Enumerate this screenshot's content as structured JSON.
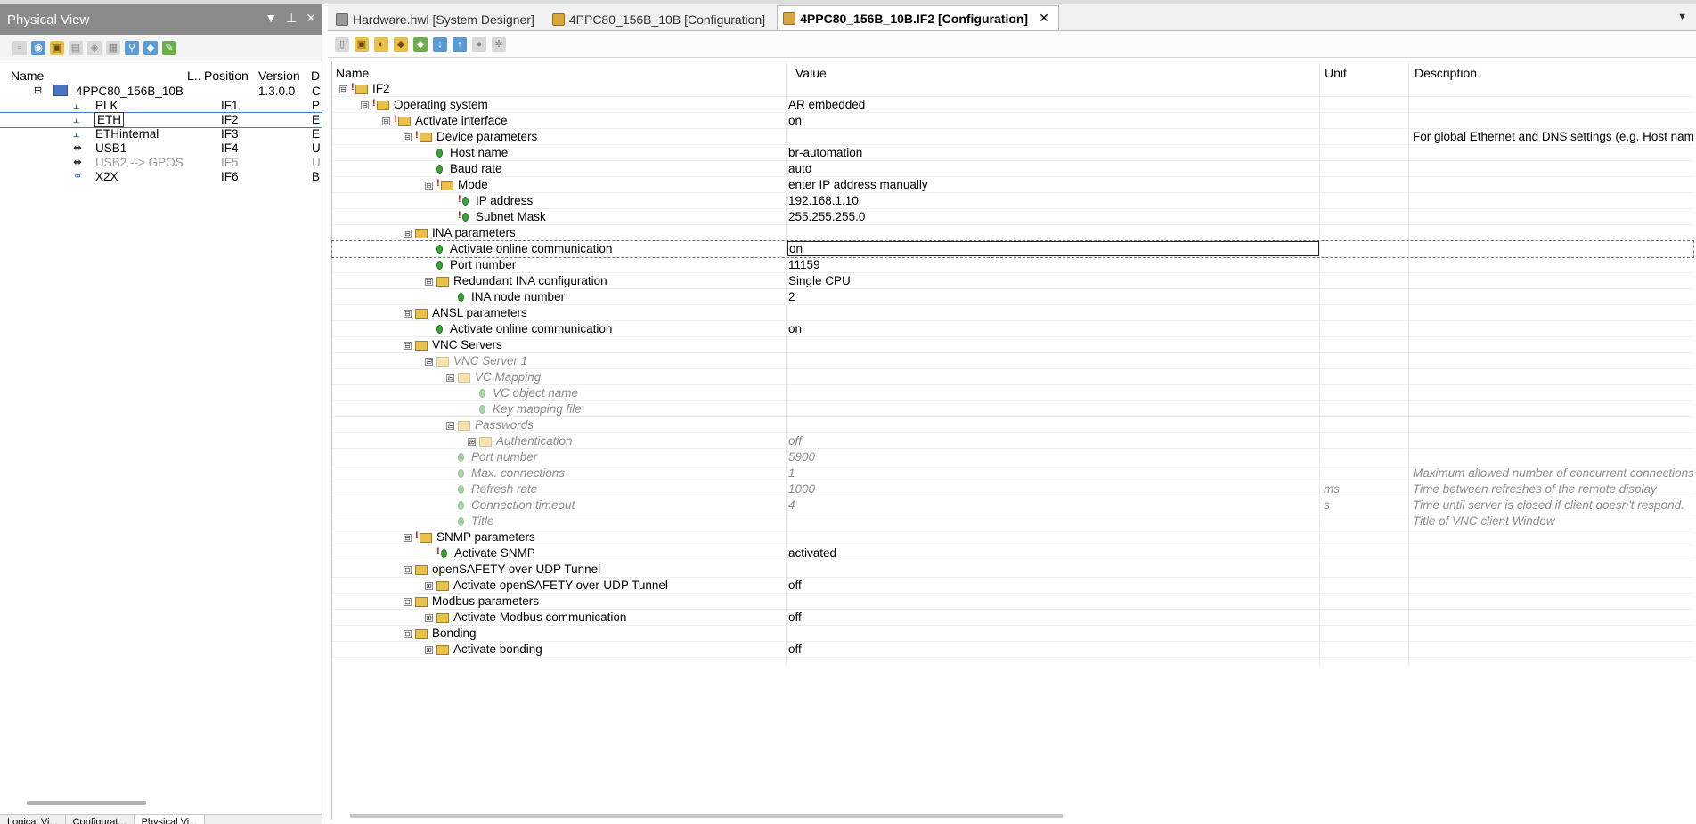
{
  "left_pane": {
    "title": "Physical View",
    "controls": [
      "▼",
      "⊥",
      "✕"
    ],
    "columns": {
      "name": "Name",
      "l": "L..",
      "position": "Position",
      "version": "Version",
      "d": "D"
    },
    "items": [
      {
        "name": "4PPC80_156B_10B",
        "position": "",
        "version": "1.3.0.0",
        "d": "C",
        "indent": 0,
        "kind": "device",
        "expander": "⊟"
      },
      {
        "name": "PLK",
        "position": "IF1",
        "version": "",
        "d": "P",
        "indent": 1,
        "kind": "net"
      },
      {
        "name": "ETH",
        "position": "IF2",
        "version": "",
        "d": "E",
        "indent": 1,
        "kind": "net",
        "selected": true
      },
      {
        "name": "ETHinternal",
        "position": "IF3",
        "version": "",
        "d": "E",
        "indent": 1,
        "kind": "net"
      },
      {
        "name": "USB1",
        "position": "IF4",
        "version": "",
        "d": "U",
        "indent": 1,
        "kind": "usb"
      },
      {
        "name": "USB2 --> GPOS",
        "position": "IF5",
        "version": "",
        "d": "U",
        "indent": 1,
        "kind": "usb",
        "grey": true
      },
      {
        "name": "X2X",
        "position": "IF6",
        "version": "",
        "d": "B",
        "indent": 1,
        "kind": "x2x"
      }
    ],
    "bottom_tabs": [
      "Logical Vi...",
      "Configurat...",
      "Physical Vi..."
    ]
  },
  "tabs": [
    {
      "label": "Hardware.hwl [System Designer]",
      "active": false,
      "icon": "hardware-icon"
    },
    {
      "label": "4PPC80_156B_10B [Configuration]",
      "active": false,
      "icon": "configuration-icon"
    },
    {
      "label": "4PPC80_156B_10B.IF2 [Configuration]",
      "active": true,
      "icon": "configuration-icon",
      "close": "✕"
    }
  ],
  "tab_menu_glyph": "▼",
  "grid": {
    "columns": {
      "name": "Name",
      "value": "Value",
      "unit": "Unit",
      "description": "Description"
    },
    "rows": [
      {
        "level": 0,
        "exp": "⊟",
        "type": "folder",
        "warn": true,
        "name": "IF2",
        "value": "",
        "unit": "",
        "desc": ""
      },
      {
        "level": 1,
        "exp": "⊟",
        "type": "folder",
        "warn": true,
        "name": "Operating system",
        "value": "AR embedded",
        "unit": "",
        "desc": ""
      },
      {
        "level": 2,
        "exp": "⊟",
        "type": "folder",
        "warn": true,
        "name": "Activate interface",
        "value": "on",
        "unit": "",
        "desc": ""
      },
      {
        "level": 3,
        "exp": "⊟",
        "type": "folder",
        "warn": true,
        "name": "Device parameters",
        "value": "",
        "unit": "",
        "desc": "For global Ethernet and DNS settings (e.g. Host name"
      },
      {
        "level": 4,
        "exp": "",
        "type": "leaf",
        "warn": false,
        "name": "Host name",
        "value": "br-automation",
        "unit": "",
        "desc": ""
      },
      {
        "level": 4,
        "exp": "",
        "type": "leaf",
        "warn": false,
        "name": "Baud rate",
        "value": "auto",
        "unit": "",
        "desc": ""
      },
      {
        "level": 4,
        "exp": "⊟",
        "type": "folder",
        "warn": true,
        "name": "Mode",
        "value": "enter IP address manually",
        "unit": "",
        "desc": ""
      },
      {
        "level": 5,
        "exp": "",
        "type": "leaf",
        "warn": true,
        "name": "IP address",
        "value": "192.168.1.10",
        "unit": "",
        "desc": ""
      },
      {
        "level": 5,
        "exp": "",
        "type": "leaf",
        "warn": true,
        "name": "Subnet Mask",
        "value": "255.255.255.0",
        "unit": "",
        "desc": ""
      },
      {
        "level": 3,
        "exp": "⊟",
        "type": "folder",
        "warn": false,
        "name": "INA parameters",
        "value": "",
        "unit": "",
        "desc": ""
      },
      {
        "level": 4,
        "exp": "",
        "type": "leaf",
        "warn": false,
        "name": "Activate online communication",
        "value": "on",
        "unit": "",
        "desc": "",
        "selected": true
      },
      {
        "level": 4,
        "exp": "",
        "type": "leaf",
        "warn": false,
        "name": "Port number",
        "value": "11159",
        "unit": "",
        "desc": ""
      },
      {
        "level": 4,
        "exp": "⊟",
        "type": "folder",
        "warn": false,
        "name": "Redundant INA configuration",
        "value": "Single CPU",
        "unit": "",
        "desc": ""
      },
      {
        "level": 5,
        "exp": "",
        "type": "leaf",
        "warn": false,
        "name": "INA node number",
        "value": "2",
        "unit": "",
        "desc": ""
      },
      {
        "level": 3,
        "exp": "⊟",
        "type": "folder",
        "warn": false,
        "name": "ANSL parameters",
        "value": "",
        "unit": "",
        "desc": ""
      },
      {
        "level": 4,
        "exp": "",
        "type": "leaf",
        "warn": false,
        "name": "Activate online communication",
        "value": "on",
        "unit": "",
        "desc": ""
      },
      {
        "level": 3,
        "exp": "⊟",
        "type": "folder",
        "warn": false,
        "name": "VNC Servers",
        "value": "",
        "unit": "",
        "desc": ""
      },
      {
        "level": 4,
        "exp": "⊟",
        "type": "folder",
        "warn": false,
        "name": "VNC Server 1",
        "value": "",
        "unit": "",
        "desc": "",
        "italic": true
      },
      {
        "level": 5,
        "exp": "⊟",
        "type": "folder",
        "warn": false,
        "name": "VC Mapping",
        "value": "",
        "unit": "",
        "desc": "",
        "italic": true
      },
      {
        "level": 6,
        "exp": "",
        "type": "leaf",
        "warn": false,
        "name": "VC object name",
        "value": "",
        "unit": "",
        "desc": "",
        "italic": true
      },
      {
        "level": 6,
        "exp": "",
        "type": "leaf",
        "warn": false,
        "name": "Key mapping file",
        "value": "",
        "unit": "",
        "desc": "",
        "italic": true
      },
      {
        "level": 5,
        "exp": "⊟",
        "type": "folder",
        "warn": false,
        "name": "Passwords",
        "value": "",
        "unit": "",
        "desc": "",
        "italic": true
      },
      {
        "level": 6,
        "exp": "⊞",
        "type": "folder",
        "warn": false,
        "name": "Authentication",
        "value": "off",
        "unit": "",
        "desc": "",
        "italic": true
      },
      {
        "level": 5,
        "exp": "",
        "type": "leaf",
        "warn": false,
        "name": "Port number",
        "value": "5900",
        "unit": "",
        "desc": "",
        "italic": true
      },
      {
        "level": 5,
        "exp": "",
        "type": "leaf",
        "warn": false,
        "name": "Max. connections",
        "value": "1",
        "unit": "",
        "desc": "Maximum allowed number of concurrent connections",
        "italic": true
      },
      {
        "level": 5,
        "exp": "",
        "type": "leaf",
        "warn": false,
        "name": "Refresh rate",
        "value": "1000",
        "unit": "ms",
        "desc": "Time between refreshes of the remote display",
        "italic": true
      },
      {
        "level": 5,
        "exp": "",
        "type": "leaf",
        "warn": false,
        "name": "Connection timeout",
        "value": "4",
        "unit": "s",
        "desc": "Time until server is closed if client doesn't respond.",
        "italic": true
      },
      {
        "level": 5,
        "exp": "",
        "type": "leaf",
        "warn": false,
        "name": "Title",
        "value": "",
        "unit": "",
        "desc": "Title of VNC client Window",
        "italic": true
      },
      {
        "level": 3,
        "exp": "⊟",
        "type": "folder",
        "warn": true,
        "name": "SNMP parameters",
        "value": "",
        "unit": "",
        "desc": ""
      },
      {
        "level": 4,
        "exp": "",
        "type": "leaf",
        "warn": true,
        "name": "Activate SNMP",
        "value": "activated",
        "unit": "",
        "desc": ""
      },
      {
        "level": 3,
        "exp": "⊟",
        "type": "folder",
        "warn": false,
        "name": "openSAFETY-over-UDP Tunnel",
        "value": "",
        "unit": "",
        "desc": ""
      },
      {
        "level": 4,
        "exp": "⊞",
        "type": "folder",
        "warn": false,
        "name": "Activate openSAFETY-over-UDP Tunnel",
        "value": "off",
        "unit": "",
        "desc": ""
      },
      {
        "level": 3,
        "exp": "⊟",
        "type": "folder",
        "warn": false,
        "name": "Modbus parameters",
        "value": "",
        "unit": "",
        "desc": ""
      },
      {
        "level": 4,
        "exp": "⊞",
        "type": "folder",
        "warn": false,
        "name": "Activate Modbus communication",
        "value": "off",
        "unit": "",
        "desc": ""
      },
      {
        "level": 3,
        "exp": "⊟",
        "type": "folder",
        "warn": false,
        "name": "Bonding",
        "value": "",
        "unit": "",
        "desc": ""
      },
      {
        "level": 4,
        "exp": "⊞",
        "type": "folder",
        "warn": false,
        "name": "Activate bonding",
        "value": "off",
        "unit": "",
        "desc": ""
      }
    ]
  }
}
